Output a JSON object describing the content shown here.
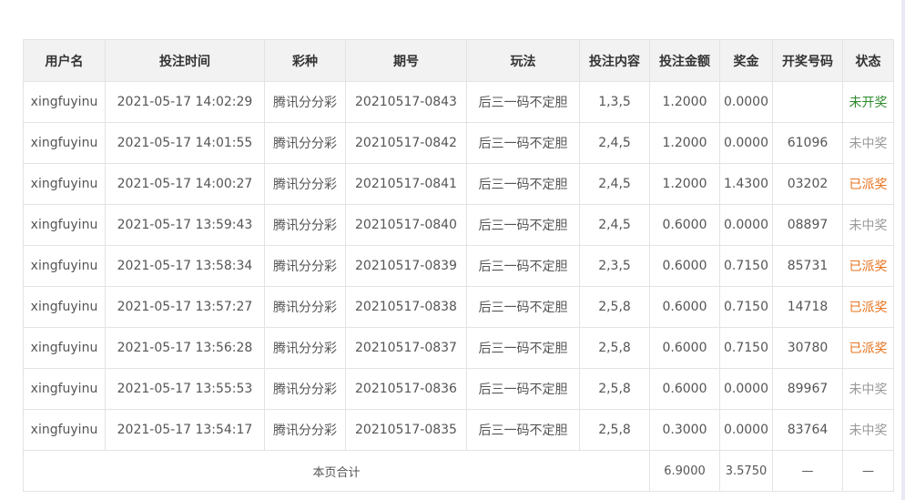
{
  "table": {
    "columns": [
      "用户名",
      "投注时间",
      "彩种",
      "期号",
      "玩法",
      "投注内容",
      "投注金额",
      "奖金",
      "开奖号码",
      "状态"
    ],
    "rows": [
      {
        "user": "xingfuyinu",
        "time": "2021-05-17 14:02:29",
        "lottery": "腾讯分分彩",
        "issue": "20210517-0843",
        "play": "后三一码不定胆",
        "content": "1,3,5",
        "amount": "1.2000",
        "prize": "0.0000",
        "numbers": "",
        "status": "未开奖",
        "status_color": "#2e8b2e"
      },
      {
        "user": "xingfuyinu",
        "time": "2021-05-17 14:01:55",
        "lottery": "腾讯分分彩",
        "issue": "20210517-0842",
        "play": "后三一码不定胆",
        "content": "2,4,5",
        "amount": "1.2000",
        "prize": "0.0000",
        "numbers": "61096",
        "status": "未中奖",
        "status_color": "#999999"
      },
      {
        "user": "xingfuyinu",
        "time": "2021-05-17 14:00:27",
        "lottery": "腾讯分分彩",
        "issue": "20210517-0841",
        "play": "后三一码不定胆",
        "content": "2,4,5",
        "amount": "1.2000",
        "prize": "1.4300",
        "numbers": "03202",
        "status": "已派奖",
        "status_color": "#e8731e"
      },
      {
        "user": "xingfuyinu",
        "time": "2021-05-17 13:59:43",
        "lottery": "腾讯分分彩",
        "issue": "20210517-0840",
        "play": "后三一码不定胆",
        "content": "2,4,5",
        "amount": "0.6000",
        "prize": "0.0000",
        "numbers": "08897",
        "status": "未中奖",
        "status_color": "#999999"
      },
      {
        "user": "xingfuyinu",
        "time": "2021-05-17 13:58:34",
        "lottery": "腾讯分分彩",
        "issue": "20210517-0839",
        "play": "后三一码不定胆",
        "content": "2,3,5",
        "amount": "0.6000",
        "prize": "0.7150",
        "numbers": "85731",
        "status": "已派奖",
        "status_color": "#e8731e"
      },
      {
        "user": "xingfuyinu",
        "time": "2021-05-17 13:57:27",
        "lottery": "腾讯分分彩",
        "issue": "20210517-0838",
        "play": "后三一码不定胆",
        "content": "2,5,8",
        "amount": "0.6000",
        "prize": "0.7150",
        "numbers": "14718",
        "status": "已派奖",
        "status_color": "#e8731e"
      },
      {
        "user": "xingfuyinu",
        "time": "2021-05-17 13:56:28",
        "lottery": "腾讯分分彩",
        "issue": "20210517-0837",
        "play": "后三一码不定胆",
        "content": "2,5,8",
        "amount": "0.6000",
        "prize": "0.7150",
        "numbers": "30780",
        "status": "已派奖",
        "status_color": "#e8731e"
      },
      {
        "user": "xingfuyinu",
        "time": "2021-05-17 13:55:53",
        "lottery": "腾讯分分彩",
        "issue": "20210517-0836",
        "play": "后三一码不定胆",
        "content": "2,5,8",
        "amount": "0.6000",
        "prize": "0.0000",
        "numbers": "89967",
        "status": "未中奖",
        "status_color": "#999999"
      },
      {
        "user": "xingfuyinu",
        "time": "2021-05-17 13:54:17",
        "lottery": "腾讯分分彩",
        "issue": "20210517-0835",
        "play": "后三一码不定胆",
        "content": "2,5,8",
        "amount": "0.3000",
        "prize": "0.0000",
        "numbers": "83764",
        "status": "未中奖",
        "status_color": "#999999"
      }
    ],
    "footer": {
      "label": "本页合计",
      "amount": "6.9000",
      "prize": "3.5750",
      "numbers": "—",
      "status": "—"
    }
  }
}
